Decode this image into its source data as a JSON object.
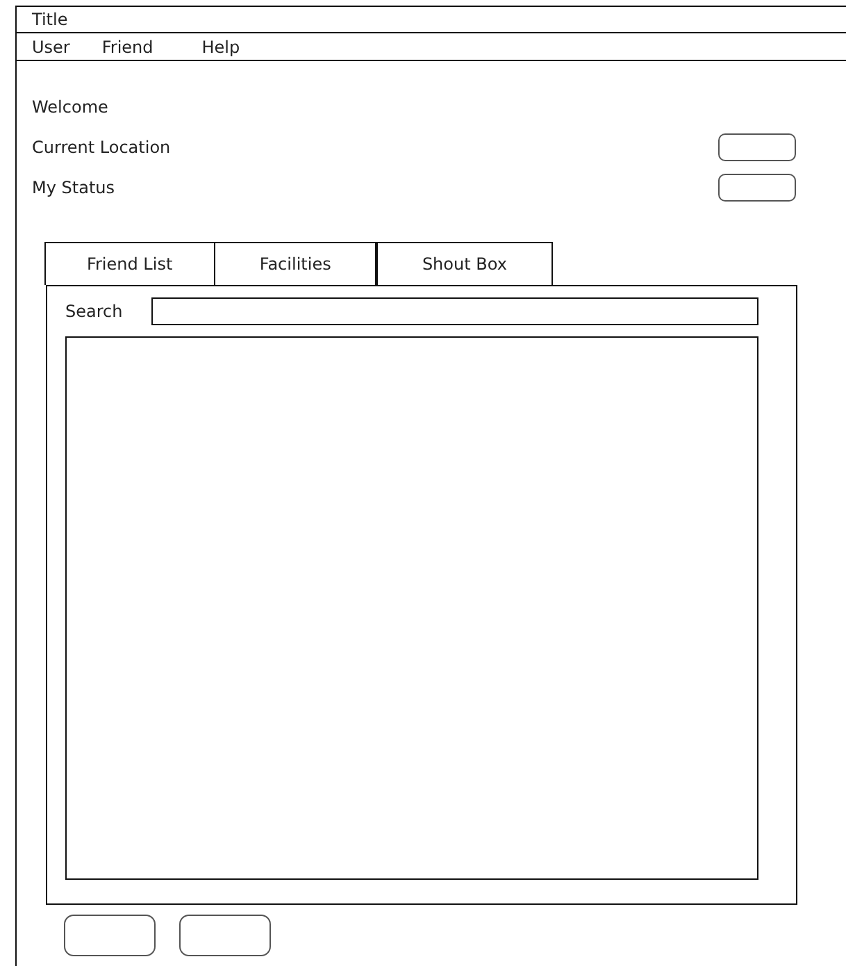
{
  "window": {
    "title": "Title"
  },
  "menu": [
    "User",
    "Friend",
    "Help"
  ],
  "welcome": "Welcome",
  "fields": [
    {
      "label": "Current Location"
    },
    {
      "label": "My Status"
    }
  ],
  "tabs": [
    {
      "label": "Friend List"
    },
    {
      "label": "Facilities"
    },
    {
      "label": "Shout Box"
    }
  ],
  "search": {
    "label": "Search"
  }
}
